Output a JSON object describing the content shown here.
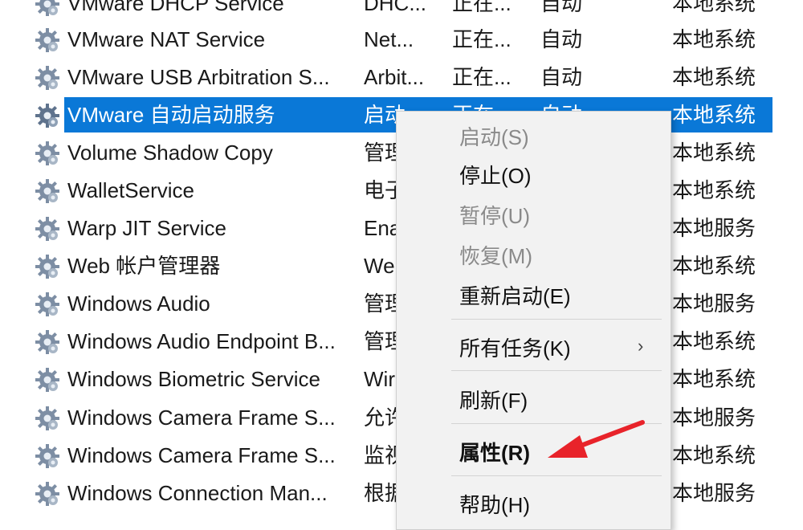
{
  "services": [
    {
      "name": "VMware DHCP Service",
      "desc": "DHC...",
      "status": "正在...",
      "startup": "自动",
      "logon": "本地系统"
    },
    {
      "name": "VMware NAT Service",
      "desc": "Net...",
      "status": "正在...",
      "startup": "自动",
      "logon": "本地系统"
    },
    {
      "name": "VMware USB Arbitration S...",
      "desc": "Arbit...",
      "status": "正在...",
      "startup": "自动",
      "logon": "本地系统"
    },
    {
      "name": "VMware 自动启动服务",
      "desc": "启动",
      "status": "正在...",
      "startup": "自动",
      "logon": "本地系统"
    },
    {
      "name": "Volume Shadow Copy",
      "desc": "管理",
      "status": "",
      "startup": "",
      "logon": "本地系统"
    },
    {
      "name": "WalletService",
      "desc": "电子",
      "status": "",
      "startup": "",
      "logon": "本地系统"
    },
    {
      "name": "Warp JIT Service",
      "desc": "Ena",
      "status": "",
      "startup": "",
      "logon": "本地服务"
    },
    {
      "name": "Web 帐户管理器",
      "desc": "We",
      "status": "",
      "startup": "",
      "logon": "本地系统"
    },
    {
      "name": "Windows Audio",
      "desc": "管理",
      "status": "",
      "startup": "",
      "logon": "本地服务"
    },
    {
      "name": "Windows Audio Endpoint B...",
      "desc": "管理",
      "status": "",
      "startup": "",
      "logon": "本地系统"
    },
    {
      "name": "Windows Biometric Service",
      "desc": "Wir",
      "status": "",
      "startup": "",
      "logon": "本地系统"
    },
    {
      "name": "Windows Camera Frame S...",
      "desc": "允许",
      "status": "",
      "startup": "",
      "logon": "本地服务"
    },
    {
      "name": "Windows Camera Frame S...",
      "desc": "监视",
      "status": "",
      "startup": "",
      "logon": "本地系统"
    },
    {
      "name": "Windows Connection Man...",
      "desc": "根据",
      "status": "",
      "startup": "",
      "logon": "本地服务"
    }
  ],
  "context_menu": {
    "start": "启动(S)",
    "stop": "停止(O)",
    "pause": "暂停(U)",
    "resume": "恢复(M)",
    "restart": "重新启动(E)",
    "all_tasks": "所有任务(K)",
    "submenu_chevron": "›",
    "refresh": "刷新(F)",
    "properties": "属性(R)",
    "help": "帮助(H)"
  },
  "colors": {
    "selection": "#0a78d7",
    "annotation_arrow": "#e8232a"
  },
  "icons": {
    "service": "gear-icon",
    "annotation": "red-arrow-icon"
  }
}
